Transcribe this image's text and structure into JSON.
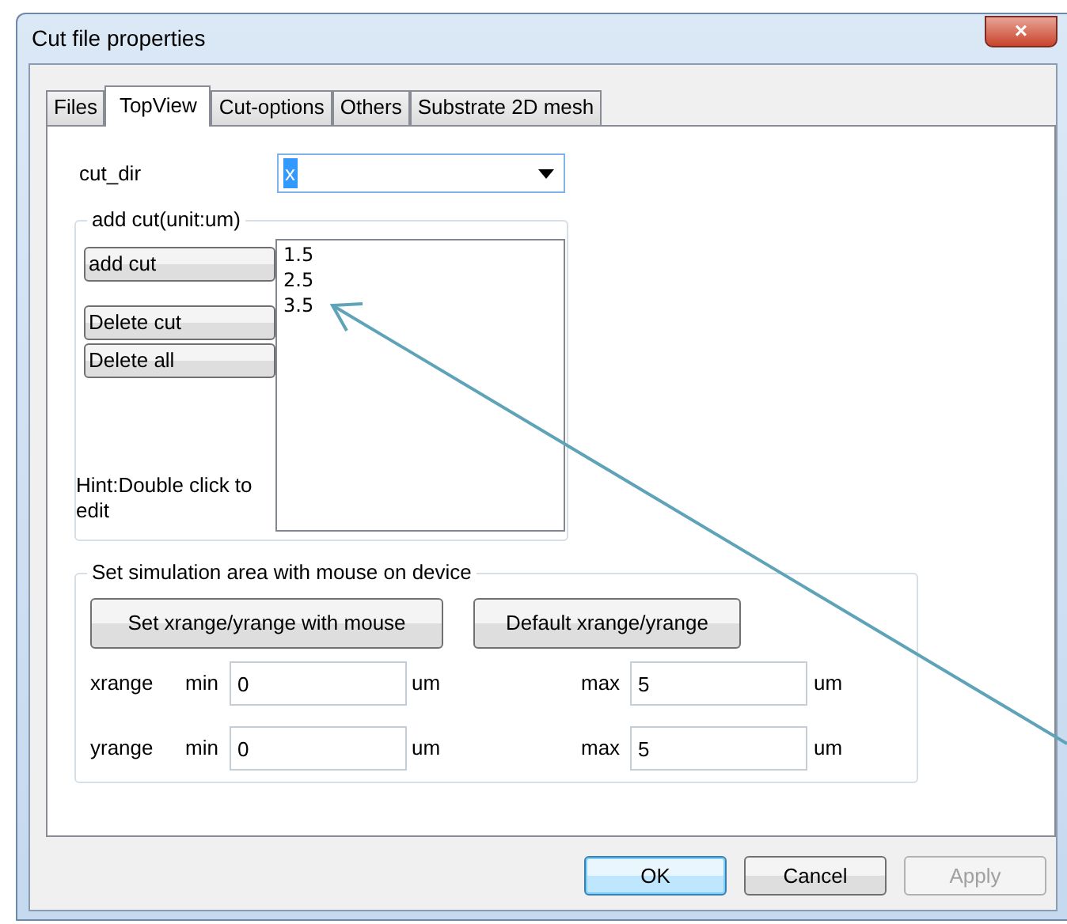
{
  "window": {
    "title": "Cut file properties",
    "close": "×"
  },
  "tabs": [
    {
      "label": "Files",
      "selected": false
    },
    {
      "label": "TopView",
      "selected": true
    },
    {
      "label": "Cut-options",
      "selected": false
    },
    {
      "label": "Others",
      "selected": false
    },
    {
      "label": "Substrate 2D mesh",
      "selected": false
    }
  ],
  "cut_dir": {
    "label": "cut_dir",
    "value": "x"
  },
  "add_cut": {
    "title": "add cut(unit:um)",
    "buttons": [
      "add cut",
      "Delete cut",
      "Delete all"
    ],
    "hint": "Hint:Double click to edit",
    "cuts": [
      "1.5",
      "2.5",
      "3.5"
    ]
  },
  "simulation_area": {
    "title": "Set simulation area with mouse on device",
    "buttons": [
      "Set xrange/yrange with mouse",
      "Default xrange/yrange"
    ],
    "rows": [
      {
        "label": "xrange",
        "min_label": "min",
        "min": "0",
        "min_unit": "um",
        "max_label": "max",
        "max": "5",
        "max_unit": "um"
      },
      {
        "label": "yrange",
        "min_label": "min",
        "min": "0",
        "min_unit": "um",
        "max_label": "max",
        "max": "5",
        "max_unit": "um"
      }
    ]
  },
  "buttons": [
    {
      "label": "OK",
      "default": true,
      "disabled": false
    },
    {
      "label": "Cancel",
      "default": false,
      "disabled": false
    },
    {
      "label": "Apply",
      "default": false,
      "disabled": true
    }
  ]
}
